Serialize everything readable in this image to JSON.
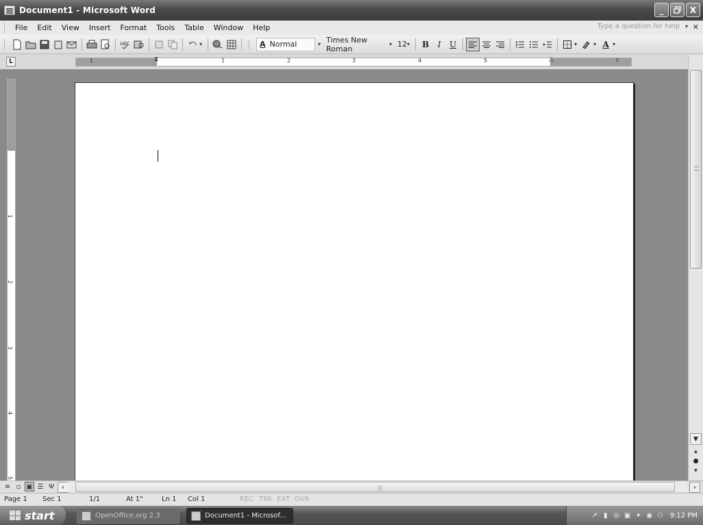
{
  "window": {
    "title": "Document1 - Microsoft Word",
    "minimize": "_",
    "maximize": "❐",
    "close": "X"
  },
  "menu": {
    "items": [
      "File",
      "Edit",
      "View",
      "Insert",
      "Format",
      "Tools",
      "Table",
      "Window",
      "Help"
    ],
    "help_placeholder": "Type a question for help",
    "help_dropdown": "▾",
    "close_doc": "✕"
  },
  "toolbar": {
    "style_icon": "A",
    "style": "Normal",
    "font": "Times New Roman",
    "size": "12",
    "bold": "B",
    "italic": "I",
    "underline": "U",
    "font_color_label": "A"
  },
  "ruler": {
    "tab_selector": "L",
    "numbers": [
      "1",
      "1",
      "2",
      "3",
      "4",
      "5",
      "7"
    ]
  },
  "vruler": {
    "numbers": [
      "1",
      "2",
      "3",
      "4",
      "5"
    ]
  },
  "status": {
    "page": "Page 1",
    "sec": "Sec 1",
    "pages": "1/1",
    "at": "At 1\"",
    "ln": "Ln 1",
    "col": "Col 1",
    "rec": "REC",
    "trk": "TRK",
    "ext": "EXT",
    "ovr": "OVR"
  },
  "taskbar": {
    "start": "start",
    "tasks": [
      "OpenOffice.org 2.3",
      "Document1 - Microsof..."
    ],
    "clock": "9:12 PM"
  },
  "icons": {
    "new": "new-document-icon",
    "open": "open-folder-icon",
    "save": "save-disk-icon"
  }
}
